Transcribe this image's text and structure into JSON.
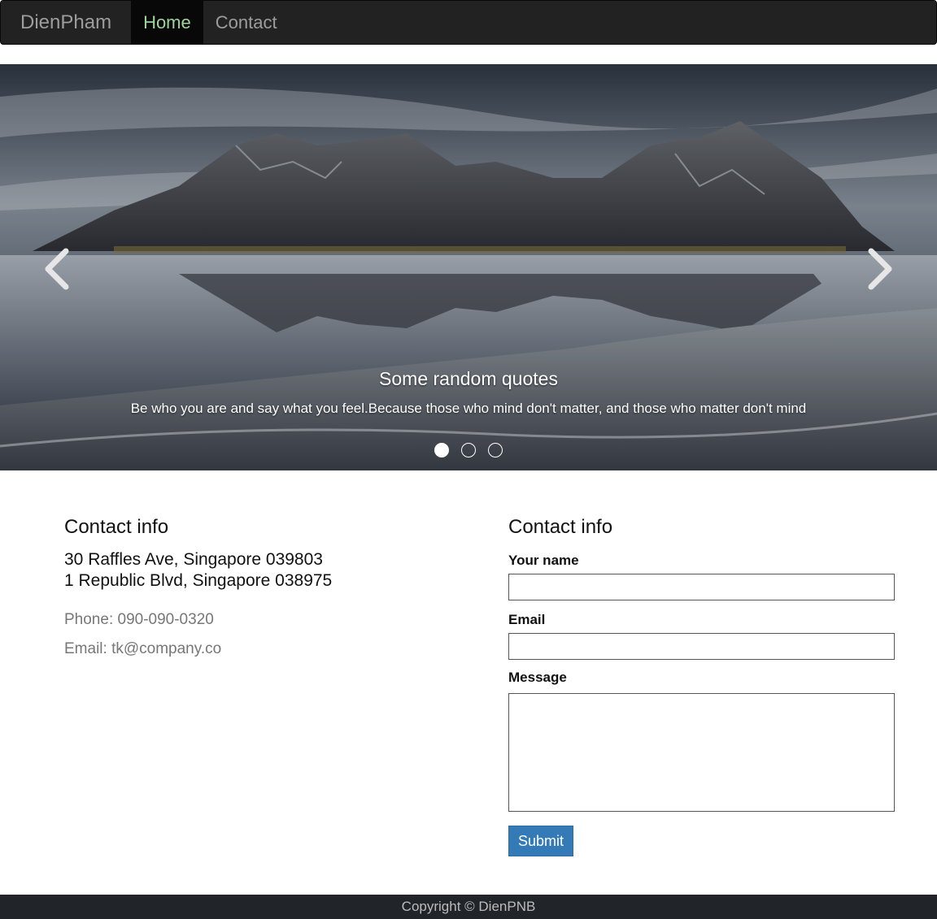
{
  "navbar": {
    "brand": "DienPham",
    "items": [
      {
        "label": "Home",
        "active": true
      },
      {
        "label": "Contact",
        "active": false
      }
    ]
  },
  "carousel": {
    "caption_title": "Some random quotes",
    "caption_text": "Be who you are and say what you feel.Because those who mind don't matter, and those who matter don't mind",
    "slide_count": 3,
    "active_slide": 1,
    "prev_icon": "chevron-left-icon",
    "next_icon": "chevron-right-icon"
  },
  "contact_info": {
    "title": "Contact info",
    "address_line1": "30 Raffles Ave, Singapore 039803",
    "address_line2": "1 Republic Blvd, Singapore 038975",
    "phone": "Phone: 090-090-0320",
    "email": "Email: tk@company.co"
  },
  "contact_form": {
    "title": "Contact info",
    "name_label": "Your name",
    "name_value": "",
    "email_label": "Email",
    "email_value": "",
    "message_label": "Message",
    "message_value": "",
    "submit_label": "Submit"
  },
  "footer": {
    "text": "Copyright © DienPNB"
  },
  "colors": {
    "navbar_bg": "#222222",
    "nav_active_text": "#9dd39d",
    "button_primary": "#337ab7",
    "footer_bg": "#212529"
  }
}
